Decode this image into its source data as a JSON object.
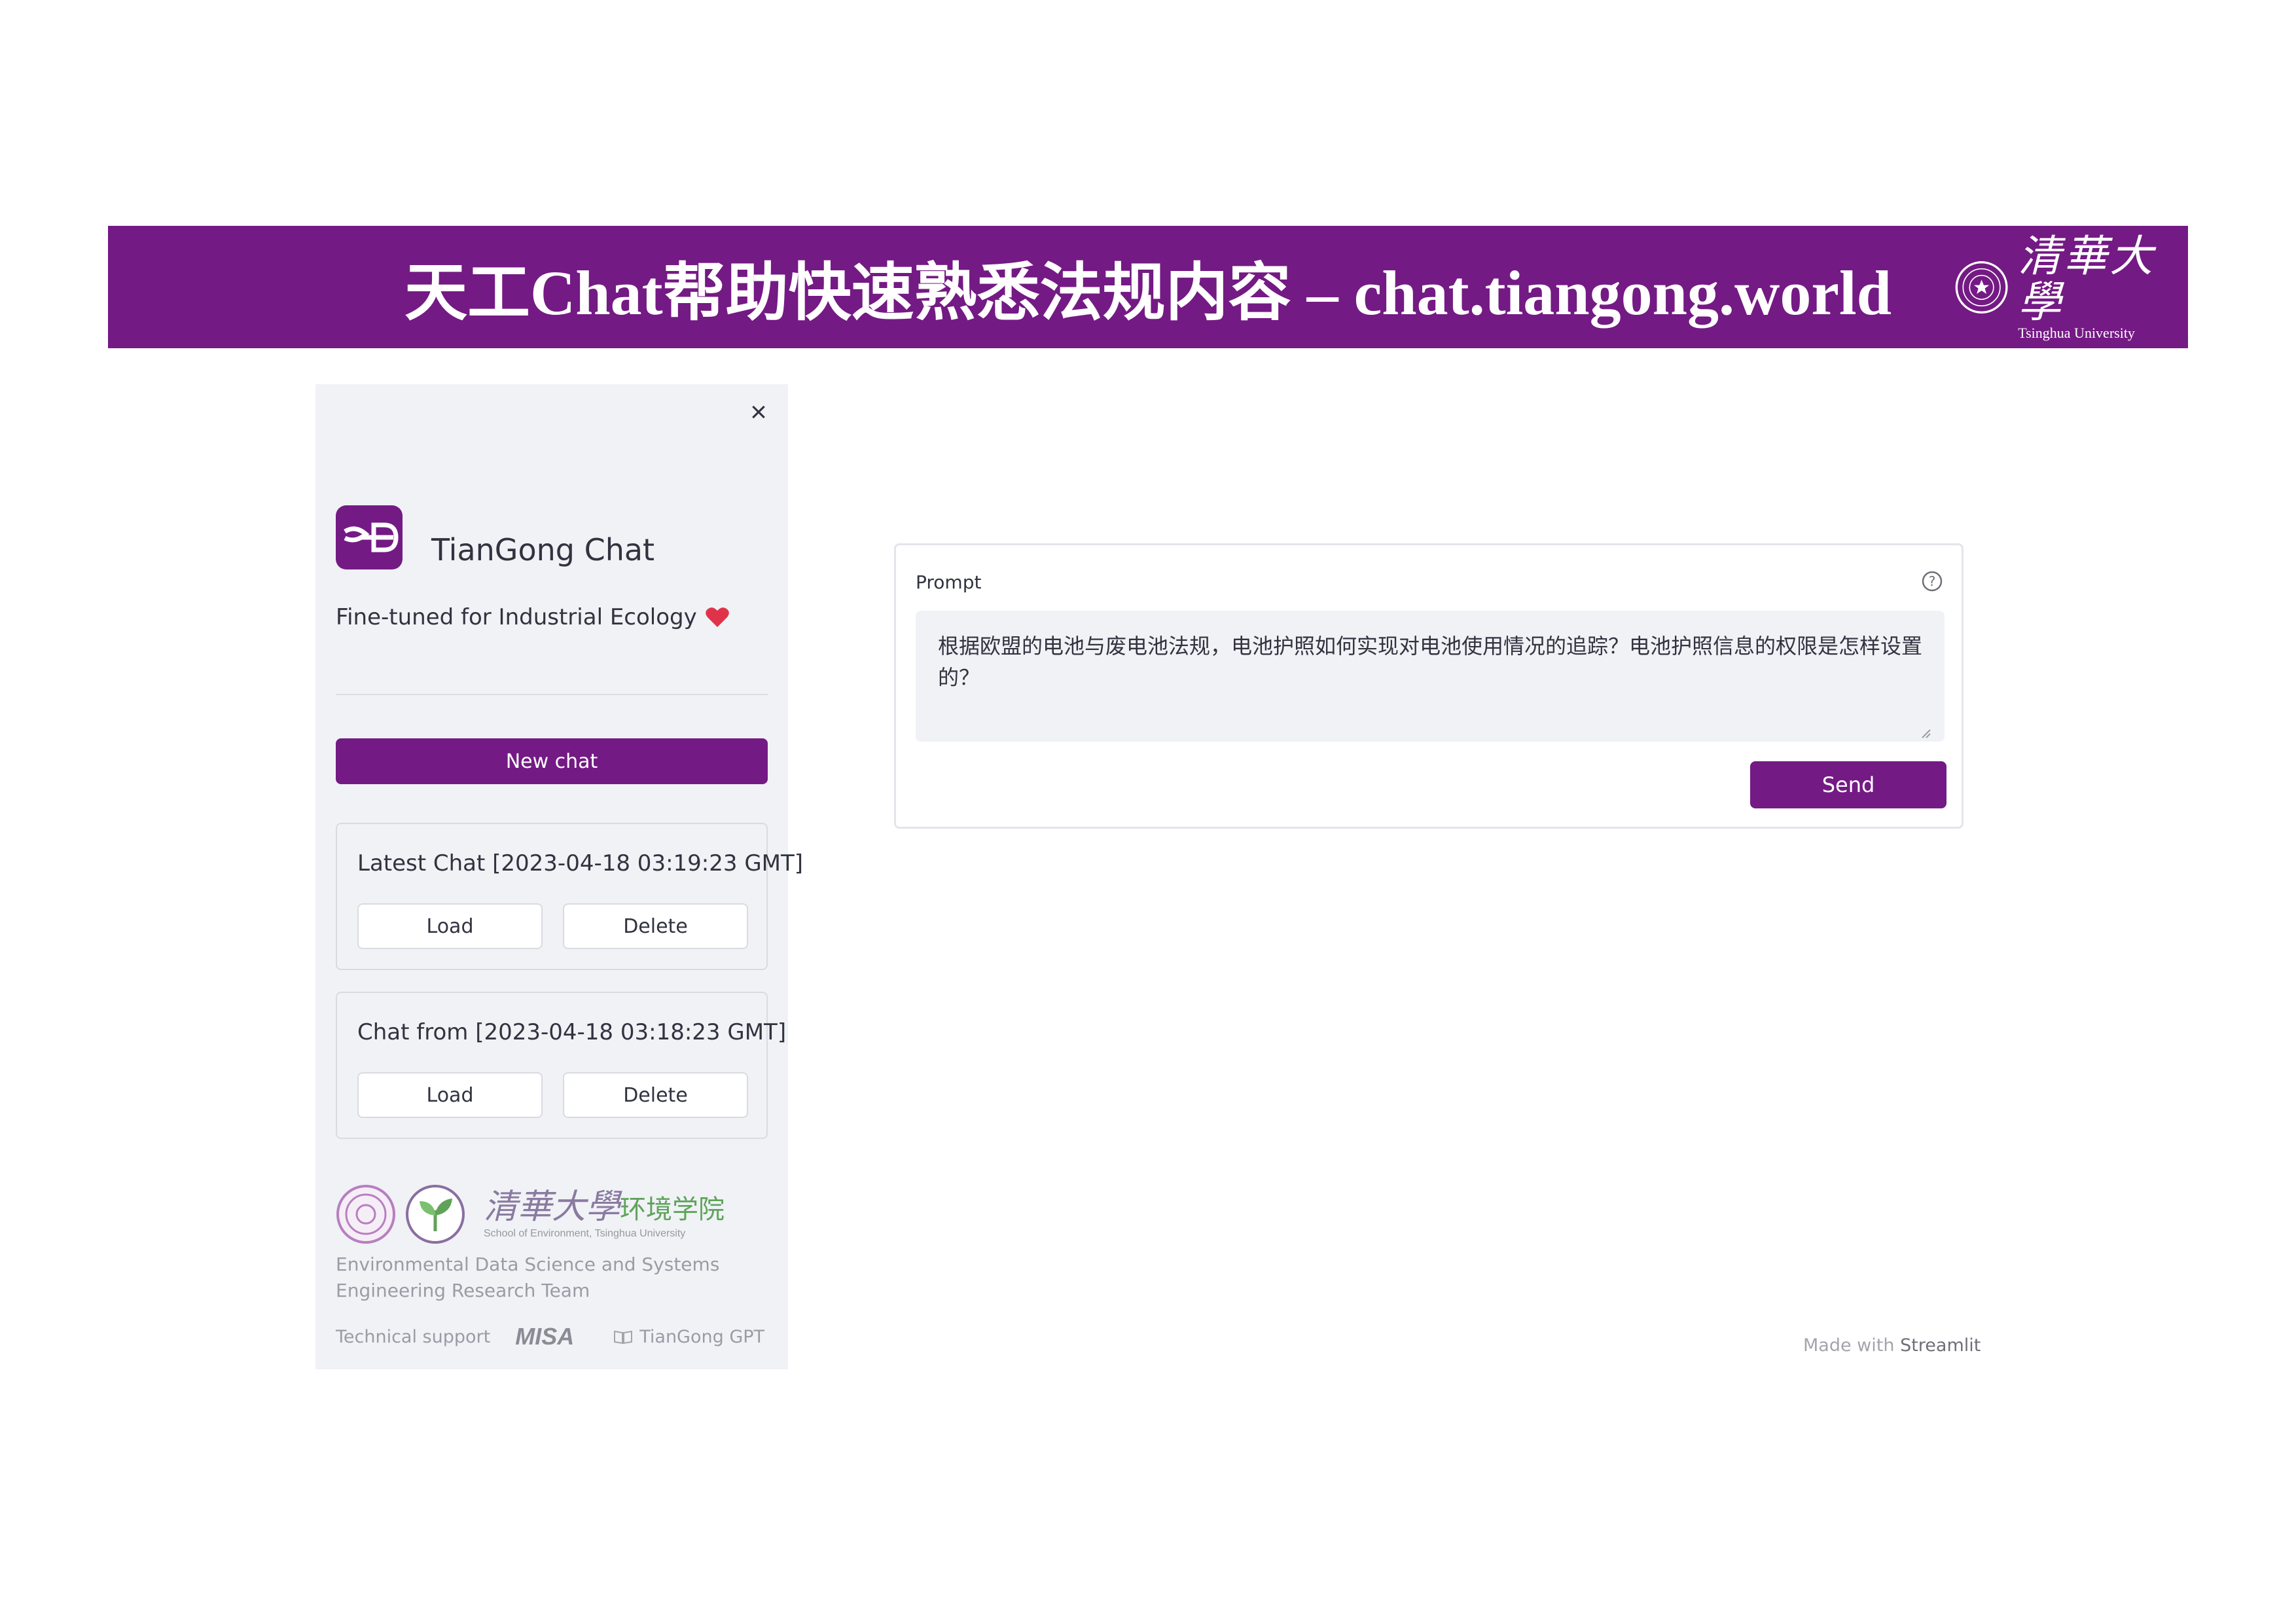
{
  "banner": {
    "title": "天工Chat帮助快速熟悉法规内容 – chat.tiangong.world",
    "logo_cn": "清華大學",
    "logo_en": "Tsinghua University",
    "color": "#741a84"
  },
  "sidebar": {
    "app_name": "TianGong Chat",
    "tagline": "Fine-tuned for Industrial Ecology",
    "new_chat_label": "New chat",
    "chats": [
      {
        "title": "Latest Chat [2023-04-18 03:19:23 GMT]",
        "load_label": "Load",
        "delete_label": "Delete"
      },
      {
        "title": "Chat from [2023-04-18 03:18:23 GMT]",
        "load_label": "Load",
        "delete_label": "Delete"
      }
    ],
    "footer": {
      "school_cn_a": "清華大學",
      "school_cn_b": "环境学院",
      "school_en": "School of Environment, Tsinghua University",
      "team": "Environmental Data Science and Systems Engineering Research Team",
      "support_label": "Technical support",
      "misa": "MISA",
      "tiangong_gpt": "TianGong GPT"
    }
  },
  "main": {
    "prompt_label": "Prompt",
    "prompt_value": "根据欧盟的电池与废电池法规，电池护照如何实现对电池使用情况的追踪？电池护照信息的权限是怎样设置的？",
    "send_label": "Send"
  },
  "footer": {
    "made_with": "Made with",
    "brand": "Streamlit"
  },
  "icons": {
    "close": "close-icon",
    "help": "help-icon",
    "heart": "heart-icon",
    "book": "book-icon"
  }
}
